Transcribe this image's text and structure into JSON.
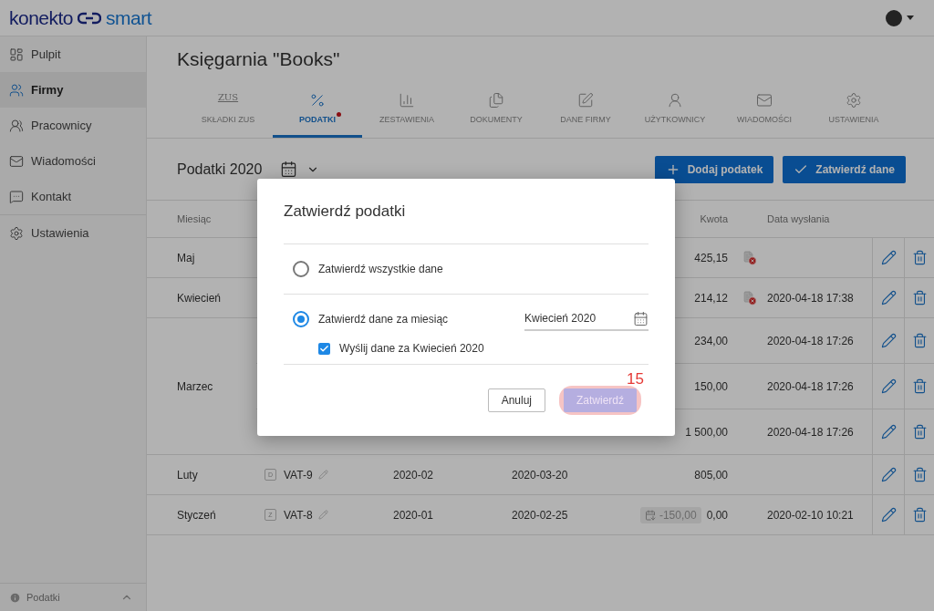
{
  "header": {
    "logo_left": "konekto",
    "logo_right": "smart"
  },
  "sidebar": {
    "items": [
      {
        "label": "Pulpit",
        "selected": false
      },
      {
        "label": "Firmy",
        "selected": true
      },
      {
        "label": "Pracownicy",
        "selected": false
      },
      {
        "label": "Wiadomości",
        "selected": false
      },
      {
        "label": "Kontakt",
        "selected": false
      },
      {
        "label": "Ustawienia",
        "selected": false
      }
    ],
    "footer": {
      "label": "Podatki"
    }
  },
  "page": {
    "title": "Księgarnia \"Books\""
  },
  "tabs": [
    {
      "label": "SKŁADKI ZUS",
      "icon_text": "ZUS",
      "selected": false,
      "dot": false
    },
    {
      "label": "PODATKI",
      "selected": true,
      "dot": true
    },
    {
      "label": "ZESTAWIENIA",
      "selected": false,
      "dot": false
    },
    {
      "label": "DOKUMENTY",
      "selected": false,
      "dot": false
    },
    {
      "label": "DANE FIRMY",
      "selected": false,
      "dot": false
    },
    {
      "label": "UŻYTKOWNICY",
      "selected": false,
      "dot": false
    },
    {
      "label": "WIADOMOŚCI",
      "selected": false,
      "dot": false
    },
    {
      "label": "USTAWIENIA",
      "selected": false,
      "dot": false
    }
  ],
  "toolbar": {
    "title": "Podatki 2020",
    "buttons": [
      {
        "label": "Dodaj podatek"
      },
      {
        "label": "Zatwierdź dane"
      }
    ]
  },
  "table": {
    "columns": [
      "Miesiąc",
      "Kwota",
      "Data wysłania"
    ],
    "groups": [
      {
        "month": "Maj",
        "rows": [
          {
            "amount": "425,15",
            "status_error": true
          }
        ]
      },
      {
        "month": "Kwiecień",
        "rows": [
          {
            "amount": "214,12",
            "status_error": true,
            "sent": "2020-04-18 17:38"
          }
        ]
      },
      {
        "month": "Marzec",
        "rows": [
          {
            "amount": "234,00",
            "status_error": false,
            "sent": "2020-04-18 17:26"
          },
          {
            "amount": "150,00",
            "status_error": false,
            "sent": "2020-04-18 17:26"
          },
          {
            "amount": "1 500,00",
            "status_error": false,
            "sent": "2020-04-18 17:26"
          }
        ]
      },
      {
        "month": "Luty",
        "rows": [
          {
            "badge": "D",
            "name": "VAT-9",
            "period": "2020-02",
            "deadline": "2020-03-20",
            "amount": "805,00",
            "status_error": false
          }
        ]
      },
      {
        "month": "Styczeń",
        "rows": [
          {
            "badge": "Z",
            "name": "VAT-8",
            "period": "2020-01",
            "deadline": "2020-02-25",
            "correction": "-150,00",
            "amount": "0,00",
            "status_error": false,
            "sent": "2020-02-10 10:21"
          }
        ]
      }
    ]
  },
  "dialog": {
    "title": "Zatwierdź podatki",
    "options": [
      {
        "label": "Zatwierdź wszystkie dane",
        "selected": false
      },
      {
        "label": "Zatwierdź dane za miesiąc",
        "selected": true
      }
    ],
    "month_field": {
      "value": "Kwiecień 2020"
    },
    "send_checkbox": {
      "label": "Wyślij dane za Kwiecień 2020",
      "checked": true
    },
    "buttons": [
      {
        "label": "Anuluj",
        "kind": "secondary",
        "disabled": false
      },
      {
        "label": "Zatwierdź",
        "kind": "primary",
        "disabled": true
      }
    ],
    "annotation": "15"
  }
}
